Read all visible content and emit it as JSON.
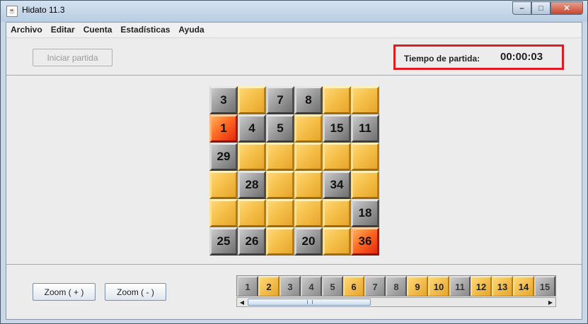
{
  "window": {
    "title": "Hidato 11.3",
    "app_icon": "java-cup-icon"
  },
  "window_controls": {
    "minimize": "–",
    "maximize": "□",
    "close": "✕"
  },
  "menu": [
    "Archivo",
    "Editar",
    "Cuenta",
    "Estadísticas",
    "Ayuda"
  ],
  "toolbar": {
    "start_label": "Iniciar partida",
    "start_enabled": false
  },
  "timer": {
    "label": "Tiempo de partida:",
    "value": "00:00:03",
    "highlight_color": "#e01b24"
  },
  "board": {
    "rows": 6,
    "cols": 6,
    "cells": [
      [
        {
          "v": "3",
          "s": "gray"
        },
        {
          "v": "",
          "s": "gold"
        },
        {
          "v": "7",
          "s": "gray"
        },
        {
          "v": "8",
          "s": "gray"
        },
        {
          "v": "",
          "s": "gold"
        },
        {
          "v": "",
          "s": "gold"
        }
      ],
      [
        {
          "v": "1",
          "s": "red"
        },
        {
          "v": "4",
          "s": "gray"
        },
        {
          "v": "5",
          "s": "gray"
        },
        {
          "v": "",
          "s": "gold"
        },
        {
          "v": "15",
          "s": "gray"
        },
        {
          "v": "11",
          "s": "gray"
        }
      ],
      [
        {
          "v": "29",
          "s": "gray"
        },
        {
          "v": "",
          "s": "gold"
        },
        {
          "v": "",
          "s": "gold"
        },
        {
          "v": "",
          "s": "gold"
        },
        {
          "v": "",
          "s": "gold"
        },
        {
          "v": "",
          "s": "gold"
        }
      ],
      [
        {
          "v": "",
          "s": "gold"
        },
        {
          "v": "28",
          "s": "gray"
        },
        {
          "v": "",
          "s": "gold"
        },
        {
          "v": "",
          "s": "gold"
        },
        {
          "v": "34",
          "s": "gray"
        },
        {
          "v": "",
          "s": "gold"
        }
      ],
      [
        {
          "v": "",
          "s": "gold"
        },
        {
          "v": "",
          "s": "gold"
        },
        {
          "v": "",
          "s": "gold"
        },
        {
          "v": "",
          "s": "gold"
        },
        {
          "v": "",
          "s": "gold"
        },
        {
          "v": "18",
          "s": "gray"
        }
      ],
      [
        {
          "v": "25",
          "s": "gray"
        },
        {
          "v": "26",
          "s": "gray"
        },
        {
          "v": "",
          "s": "gold"
        },
        {
          "v": "20",
          "s": "gray"
        },
        {
          "v": "",
          "s": "gold"
        },
        {
          "v": "36",
          "s": "red"
        }
      ]
    ]
  },
  "zoom": {
    "in_label": "Zoom ( + )",
    "out_label": "Zoom ( - )"
  },
  "palette": {
    "tiles": [
      {
        "v": "1",
        "s": "gray"
      },
      {
        "v": "2",
        "s": "gold"
      },
      {
        "v": "3",
        "s": "gray"
      },
      {
        "v": "4",
        "s": "gray"
      },
      {
        "v": "5",
        "s": "gray"
      },
      {
        "v": "6",
        "s": "gold"
      },
      {
        "v": "7",
        "s": "gray"
      },
      {
        "v": "8",
        "s": "gray"
      },
      {
        "v": "9",
        "s": "gold"
      },
      {
        "v": "10",
        "s": "gold"
      },
      {
        "v": "11",
        "s": "gray"
      },
      {
        "v": "12",
        "s": "gold"
      },
      {
        "v": "13",
        "s": "gold"
      },
      {
        "v": "14",
        "s": "gold"
      },
      {
        "v": "15",
        "s": "gray"
      }
    ],
    "scroll_left": "◀",
    "scroll_right": "▶"
  }
}
